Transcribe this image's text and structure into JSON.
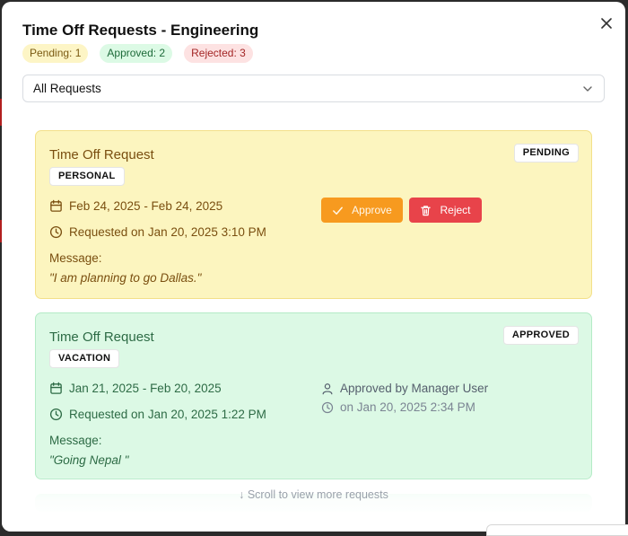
{
  "modal": {
    "title": "Time Off Requests - Engineering",
    "counts": {
      "pending": "Pending: 1",
      "approved": "Approved: 2",
      "rejected": "Rejected: 3"
    },
    "filter": {
      "selected": "All Requests"
    }
  },
  "requests": [
    {
      "title": "Time Off Request",
      "type": "PERSONAL",
      "status": "PENDING",
      "dates": "Feb 24, 2025 - Feb 24, 2025",
      "requested": "Requested on Jan 20, 2025 3:10 PM",
      "message_label": "Message:",
      "message": "\"I am planning to go Dallas.\"",
      "actions": {
        "approve": "Approve",
        "reject": "Reject"
      }
    },
    {
      "title": "Time Off Request",
      "type": "VACATION",
      "status": "APPROVED",
      "dates": "Jan 21, 2025 - Feb 20, 2025",
      "requested": "Requested on Jan 20, 2025 1:22 PM",
      "approved_by": "Approved by Manager User",
      "approved_on": "on Jan 20, 2025 2:34 PM",
      "message_label": "Message:",
      "message": "\"Going Nepal \""
    }
  ],
  "scroll_hint": "↓ Scroll to view more requests",
  "colors": {
    "pending_bg": "#fcf5bf",
    "approved_bg": "#dcf9e5",
    "approve_button": "#f79a1f",
    "reject_button": "#e8434a"
  },
  "icons": {
    "close": "close-icon",
    "dropdown": "chevron-down-icon",
    "date": "calendar-icon",
    "time": "clock-icon",
    "approve": "check-icon",
    "reject": "trash-icon",
    "approver": "user-icon"
  }
}
